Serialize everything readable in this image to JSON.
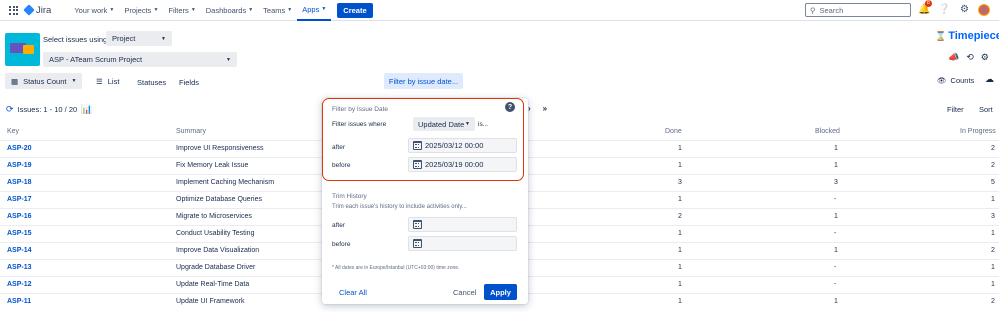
{
  "nav": {
    "product": "Jira",
    "items": [
      {
        "label": "Your work",
        "active": false
      },
      {
        "label": "Projects",
        "active": false
      },
      {
        "label": "Filters",
        "active": false
      },
      {
        "label": "Dashboards",
        "active": false
      },
      {
        "label": "Teams",
        "active": false
      },
      {
        "label": "Apps",
        "active": true
      }
    ],
    "create_label": "Create",
    "search_placeholder": "Search",
    "notification_count": "8",
    "icons": [
      "app-switcher-icon",
      "notifications-icon",
      "help-icon",
      "settings-icon"
    ]
  },
  "selector": {
    "label": "Select issues using",
    "type_value": "Project",
    "project_value": "ASP - ATeam Scrum Project"
  },
  "brand": {
    "name": "Timepiece",
    "color": "#0065ff"
  },
  "toolbar": {
    "status_count_label": "Status Count",
    "list_label": "List",
    "statuses_label": "Statuses",
    "fields_label": "Fields",
    "filter_date_label": "Filter by issue date...",
    "counts_label": "Counts"
  },
  "results": {
    "issues_label": "Issues: 1 - 10 / 20",
    "filter_label": "Filter",
    "sort_label": "Sort"
  },
  "table": {
    "columns": [
      "Key",
      "Summary",
      "Done",
      "Blocked",
      "In Progress"
    ],
    "rows": [
      {
        "key": "ASP-20",
        "summary": "Improve UI Responsiveness",
        "done": "1",
        "blocked": "1",
        "in_progress": "2"
      },
      {
        "key": "ASP-19",
        "summary": "Fix Memory Leak Issue",
        "done": "1",
        "blocked": "1",
        "in_progress": "2"
      },
      {
        "key": "ASP-18",
        "summary": "Implement Caching Mechanism",
        "done": "3",
        "blocked": "3",
        "in_progress": "5"
      },
      {
        "key": "ASP-17",
        "summary": "Optimize Database Queries",
        "done": "1",
        "blocked": "-",
        "in_progress": "1"
      },
      {
        "key": "ASP-16",
        "summary": "Migrate to Microservices",
        "done": "2",
        "blocked": "1",
        "in_progress": "3"
      },
      {
        "key": "ASP-15",
        "summary": "Conduct Usability Testing",
        "done": "1",
        "blocked": "-",
        "in_progress": "1"
      },
      {
        "key": "ASP-14",
        "summary": "Improve Data Visualization",
        "done": "1",
        "blocked": "1",
        "in_progress": "2"
      },
      {
        "key": "ASP-13",
        "summary": "Upgrade Database Driver",
        "done": "1",
        "blocked": "-",
        "in_progress": "1"
      },
      {
        "key": "ASP-12",
        "summary": "Update Real-Time Data",
        "done": "1",
        "blocked": "-",
        "in_progress": "1"
      },
      {
        "key": "ASP-11",
        "summary": "Update UI Framework",
        "done": "1",
        "blocked": "1",
        "in_progress": "2"
      }
    ]
  },
  "popover": {
    "title": "Filter by Issue Date",
    "filter_where_label": "Filter issues where",
    "field_value": "Updated Date",
    "is_label": "is...",
    "after_label": "after",
    "after_value": "2025/03/12 00:00",
    "before_label": "before",
    "before_value": "2025/03/19 00:00",
    "trim_title": "Trim History",
    "trim_desc": "Trim each issue's history to include activities only...",
    "trim_after_label": "after",
    "trim_before_label": "before",
    "note": "* All dates are in Europe/Istanbul (UTC+03:00) time zone.",
    "clear_all": "Clear All",
    "cancel": "Cancel",
    "apply": "Apply"
  }
}
